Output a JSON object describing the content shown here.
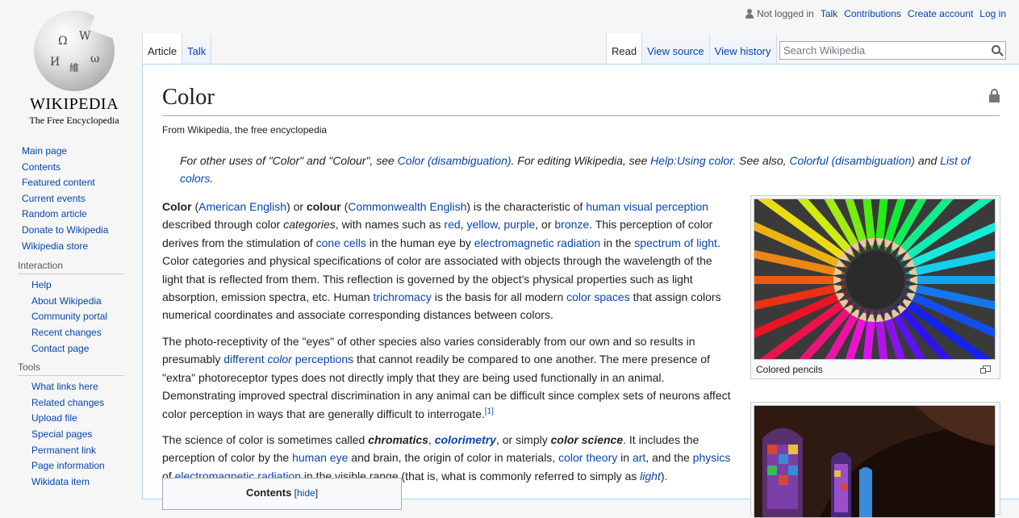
{
  "personal": {
    "not_logged_in": "Not logged in",
    "talk": "Talk",
    "contributions": "Contributions",
    "create_account": "Create account",
    "log_in": "Log in"
  },
  "logo": {
    "wordmark": "WIKIPEDIA",
    "tagline": "The Free Encyclopedia"
  },
  "tabs": {
    "article": "Article",
    "talk": "Talk",
    "read": "Read",
    "view_source": "View source",
    "view_history": "View history"
  },
  "search": {
    "placeholder": "Search Wikipedia"
  },
  "sidebar": {
    "main": [
      "Main page",
      "Contents",
      "Featured content",
      "Current events",
      "Random article",
      "Donate to Wikipedia",
      "Wikipedia store"
    ],
    "interaction": {
      "heading": "Interaction",
      "items": [
        "Help",
        "About Wikipedia",
        "Community portal",
        "Recent changes",
        "Contact page"
      ]
    },
    "tools": {
      "heading": "Tools",
      "items": [
        "What links here",
        "Related changes",
        "Upload file",
        "Special pages",
        "Permanent link",
        "Page information",
        "Wikidata item"
      ]
    }
  },
  "article": {
    "title": "Color",
    "from": "From Wikipedia, the free encyclopedia",
    "hatnote": {
      "t1": "For other uses of \"Color\" and \"Colour\", see ",
      "l1": "Color (disambiguation)",
      "t2": ". For editing Wikipedia, see ",
      "l2": "Help:Using color",
      "t3": ". See also, ",
      "l3": "Colorful (disambiguation)",
      "t4": " and ",
      "l4": "List of colors",
      "t5": "."
    },
    "p1": {
      "b1": "Color",
      "t1": " (",
      "l1": "American English",
      "t2": ") or ",
      "b2": "colour",
      "t3": " (",
      "l2": "Commonwealth English",
      "t4": ") is the characteristic of ",
      "l3": "human visual perception",
      "t5": " described through color ",
      "i1": "categories",
      "t6": ", with names such as ",
      "l4": "red",
      "t7": ", ",
      "l5": "yellow",
      "t8": ", ",
      "l6": "purple",
      "t9": ", or ",
      "l7": "bronze",
      "t10": ". This perception of color derives from the stimulation of ",
      "l8": "cone cells",
      "t11": " in the human eye by ",
      "l9": "electromagnetic radiation",
      "t12": " in the ",
      "l10": "spectrum of light",
      "t13": ". Color categories and physical specifications of color are associated with objects through the wavelength of the light that is reflected from them. This reflection is governed by the object's physical properties such as light absorption, emission spectra, etc. Human ",
      "l11": "trichromacy",
      "t14": " is the basis for all modern ",
      "l12": "color spaces",
      "t15": " that assign colors numerical coordinates and associate corresponding distances between colors."
    },
    "p2": {
      "t1": "The photo-receptivity of the \"eyes\" of other species also varies considerably from our own and so results in presumably ",
      "l1": "different ",
      "l1i": "color",
      "l1b": " perceptions",
      "t2": " that cannot readily be compared to one another. The mere presence of \"extra\" photoreceptor types does not directly imply that they are being used functionally in an animal. Demonstrating improved spectral discrimination in any animal can be difficult since complex sets of neurons affect color perception in ways that are generally difficult to interrogate.",
      "ref": "[1]"
    },
    "p3": {
      "t1": "The science of color is sometimes called ",
      "bi1": "chromatics",
      "t2": ", ",
      "li1": "colorimetry",
      "t3": ", or simply ",
      "bi2": "color science",
      "t4": ". It includes the perception of color by the ",
      "l1": "human eye",
      "t5": " and brain, the origin of color in materials, ",
      "l2": "color theory",
      "t6": " in ",
      "l3": "art",
      "t7": ", and the ",
      "l4": "physics",
      "t8": " of ",
      "l5": "electromagnetic radiation",
      "t9": " in the visible range (that is, what is commonly referred to simply as ",
      "l6i": "light",
      "t10": ")."
    },
    "thumb1_caption": "Colored pencils",
    "toc": {
      "title": "Contents",
      "hide": "hide",
      "lb": "[",
      "rb": "]"
    }
  }
}
